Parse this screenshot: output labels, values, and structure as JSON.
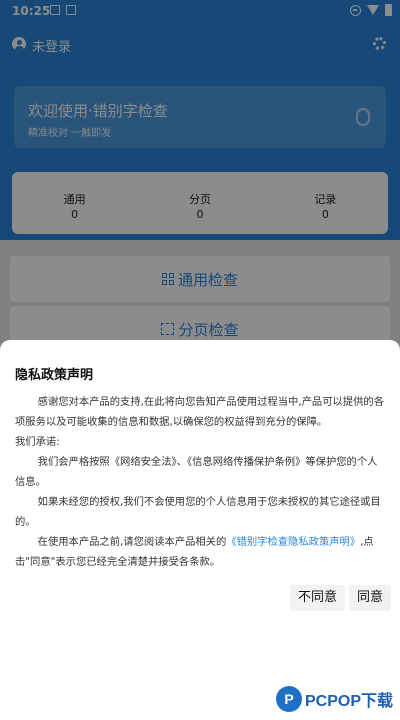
{
  "status_bar": {
    "time": "10:25"
  },
  "header": {
    "login_label": "未登录",
    "welcome_title": "欢迎使用·错别字检查",
    "welcome_subtitle": "精准校对 一触即发"
  },
  "stats": [
    {
      "label": "通用",
      "value": "0"
    },
    {
      "label": "分页",
      "value": "0"
    },
    {
      "label": "记录",
      "value": "0"
    }
  ],
  "menu": {
    "general_check": "通用检查",
    "page_check": "分页检查"
  },
  "dialog": {
    "title": "隐私政策声明",
    "para1": "感谢您对本产品的支持,在此将向您告知产品使用过程当中,产品可以提供的各项服务以及可能收集的信息和数据,以确保您的权益得到充分的保障。",
    "promise_label": "我们承诺:",
    "para2": "我们会严格按照《网络安全法》、《信息网络传播保护条例》等保护您的个人信息。",
    "para3": "如果未经您的授权,我们不会使用您的个人信息用于您未授权的其它途径或目的。",
    "para4_prefix": "在使用本产品之前,请您阅读本产品相关的",
    "policy_link": "《错别字检查隐私政策声明》",
    "para4_suffix": ",点击\"同意\"表示您已经完全清楚并接受各条款。",
    "disagree_label": "不同意",
    "agree_label": "同意"
  },
  "watermark": {
    "text": "PCPOP下载"
  },
  "colors": {
    "primary": "#2a86db",
    "overlay": "rgba(0,0,0,0.45)"
  }
}
